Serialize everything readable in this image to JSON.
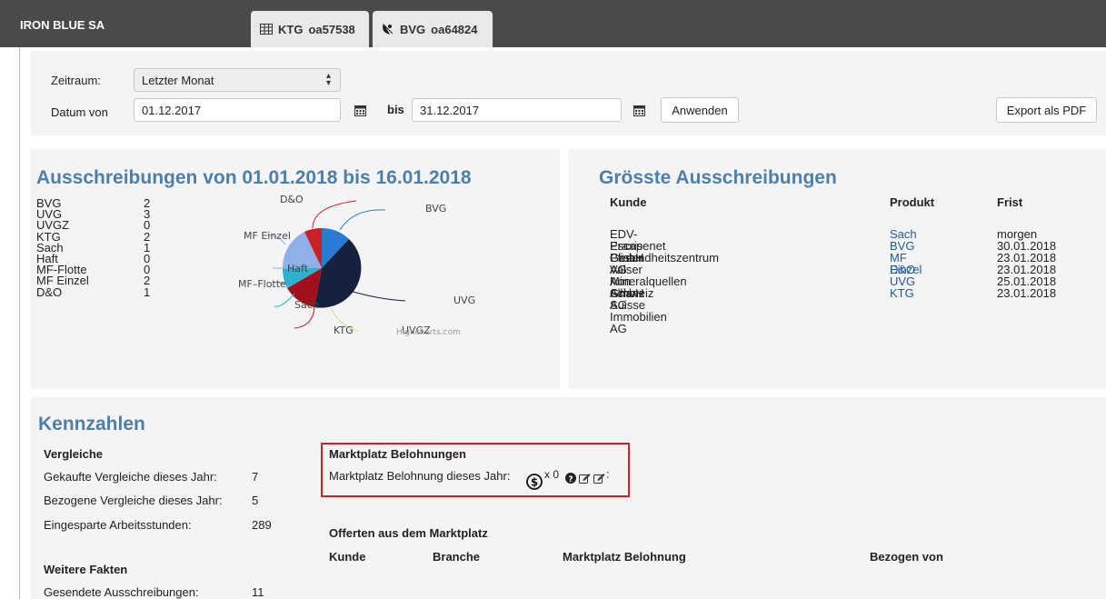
{
  "app": {
    "company": "IRON BLUE SA"
  },
  "tabs": [
    {
      "label": "KTG",
      "code": "oa57538",
      "icon": "table-icon"
    },
    {
      "label": "BVG",
      "code": "oa64824",
      "icon": "satellite-dish-icon"
    }
  ],
  "filter": {
    "period_label": "Zeitraum:",
    "period_value": "Letzter Monat",
    "date_from_label": "Datum von",
    "date_from": "01.12.2017",
    "bis_label": "bis",
    "date_to": "31.12.2017",
    "apply_label": "Anwenden",
    "export_label": "Export als PDF"
  },
  "tenders": {
    "title": "Ausschreibungen von 01.01.2018 bis 16.01.2018",
    "counts": [
      {
        "name": "BVG",
        "value": "2"
      },
      {
        "name": "UVG",
        "value": "3"
      },
      {
        "name": "UVGZ",
        "value": "0"
      },
      {
        "name": "KTG",
        "value": "2"
      },
      {
        "name": "Sach",
        "value": "1"
      },
      {
        "name": "Haft",
        "value": "0"
      },
      {
        "name": "MF-Flotte",
        "value": "0"
      },
      {
        "name": "MF Einzel",
        "value": "2"
      },
      {
        "name": "D&O",
        "value": "1"
      }
    ],
    "pie_labels": {
      "do": "D&O",
      "bvg": "BVG",
      "mf_einzel": "MF Einzel",
      "haft": "Haft",
      "mf_flotte": "MF–Flotte",
      "sach": "Sach",
      "uvg": "UVG",
      "ktg": "KTG",
      "uvgz": "UVGZ"
    },
    "credit": "Highcharts.com",
    "colors": {
      "bvg": "#2b7bd6",
      "uvg": "#16213e",
      "ktg": "#a3101c",
      "sach": "#2fb0cf",
      "mf_einzel": "#8fb1e8",
      "do": "#cc2027"
    }
  },
  "largest": {
    "title": "Grösste Ausschreibungen",
    "headers": {
      "kunde": "Kunde",
      "produkt": "Produkt",
      "frist": "Frist"
    },
    "rows": [
      {
        "kunde": "EDV-Praxis Pfister AG",
        "produkt": "Sach",
        "frist": "morgen"
      },
      {
        "kunde": "Escapenet GmbH",
        "produkt": "BVG",
        "frist": "30.01.2018"
      },
      {
        "kunde": "Gesundheitszentrum AG",
        "produkt": "MF Einzel",
        "frist": "23.01.2018"
      },
      {
        "kunde": "Valser Mineralquellen GmbH",
        "produkt": "D&O",
        "frist": "23.01.2018"
      },
      {
        "kunde": "Aon Schweiz AG",
        "produkt": "UVG",
        "frist": "25.01.2018"
      },
      {
        "kunde": "Allianz Suisse Immobilien AG",
        "produkt": "KTG",
        "frist": "23.01.2018"
      }
    ]
  },
  "kennzahlen": {
    "title": "Kennzahlen",
    "vergleiche_title": "Vergleiche",
    "stats": [
      {
        "label": "Gekaufte Vergleiche dieses Jahr:",
        "value": "7"
      },
      {
        "label": "Bezogene Vergleiche dieses Jahr:",
        "value": "5"
      },
      {
        "label": "Eingesparte Arbeitsstunden:",
        "value": "289"
      }
    ],
    "weitere_title": "Weitere Fakten",
    "weitere": [
      {
        "label": "Gesendete Ausschreibungen:",
        "value": "11"
      }
    ],
    "marktplatz": {
      "title": "Marktplatz Belohnungen",
      "line_label": "Marktplatz Belohnung dieses Jahr:",
      "multiplier": "x 0",
      "trailing": ":"
    },
    "offerten": {
      "title": "Offerten aus dem Marktplatz",
      "headers": {
        "kunde": "Kunde",
        "branche": "Branche",
        "belohnung": "Marktplatz Belohnung",
        "bezogen": "Bezogen von"
      }
    }
  }
}
